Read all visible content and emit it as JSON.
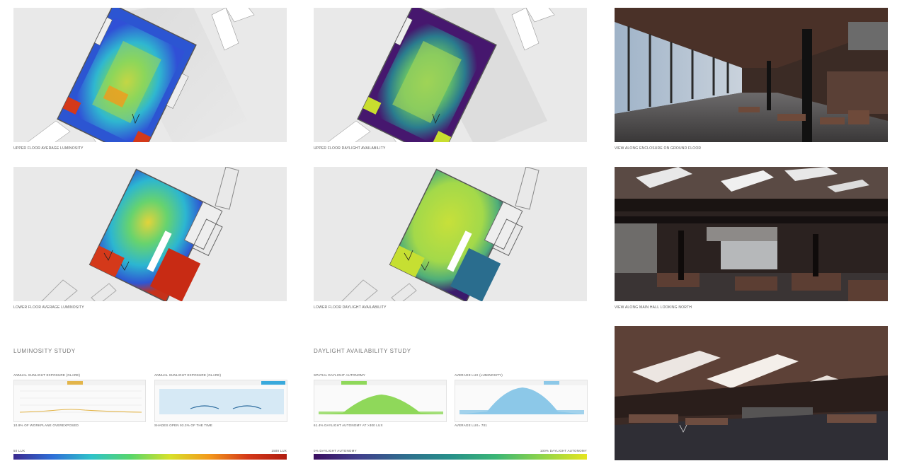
{
  "captions": {
    "c1": "UPPER FLOOR AVERAGE LUMINOSITY",
    "c2": "UPPER FLOOR DAYLIGHT AVAILABILITY",
    "c3": "VIEW ALONG ENCLOSURE  ON GROUND FLOOR",
    "c4": "LOWER FLOOR AVERAGE LUMINOSITY",
    "c5": "LOWER FLOOR DAYLIGHT AVAILABILITY",
    "c6": "VIEW ALONG MAIN HALL LOOKING NORTH"
  },
  "luminosity": {
    "title": "LUMINOSITY STUDY",
    "chart1_label": "ANNUAL SUNLIGHT EXPOSURE (GLARE)",
    "chart1_note": "10.9% OF WORKPLANE OVEREXPOSED",
    "chart2_label": "ANNUAL SUNLIGHT EXPOSURE (GLARE)",
    "chart2_note": "SHADES OPEN 93.3% OF THE TIME",
    "scale_min": "50 LUX",
    "scale_max": "1500 LUX"
  },
  "daylight": {
    "title": "DAYLIGHT AVAILABILITY STUDY",
    "chart1_label": "SPATIAL DAYLIGHT AUTONOMY",
    "chart1_note": "61.4% DAYLIGHT AUTONOMY AT >300 LUX",
    "chart2_label": "AVERAGE LUX (LUMINOSITY)",
    "chart2_note": "AVERAGE LUX= 701",
    "scale_min": "0% DAYLIGHT AUTONOMY",
    "scale_max": "100% DAYLIGHT AUTONOMY"
  },
  "colors": {
    "luminosity_scale": [
      "#3b2a8f",
      "#2f6fd8",
      "#2fc3c9",
      "#58d66b",
      "#d7e12a",
      "#f39a1c",
      "#d4391a",
      "#b01c10"
    ],
    "daylight_scale": [
      "#3b0f60",
      "#413f8c",
      "#2f6e8e",
      "#27908a",
      "#3bb676",
      "#8fd44a",
      "#e6e51f"
    ],
    "glare_accent": "#e3b54a",
    "shade_accent": "#39a9dc",
    "sda_accent": "#8fd85a",
    "lux_accent": "#8cc8e8"
  }
}
